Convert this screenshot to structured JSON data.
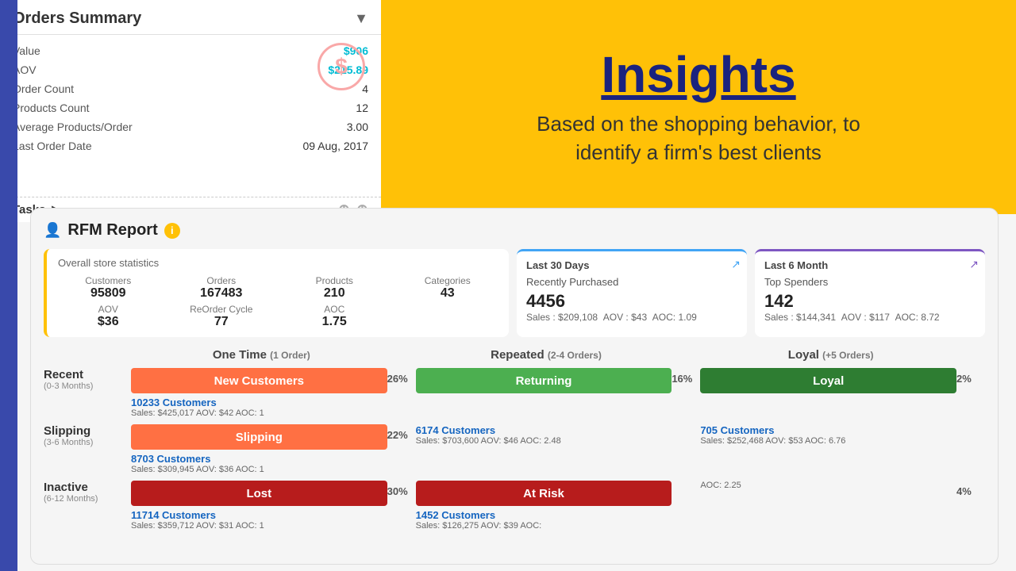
{
  "sidebar": {
    "bg": "#3949AB"
  },
  "orders_summary": {
    "title": "Orders Summary",
    "dropdown_icon": "▼",
    "rows": [
      {
        "label": "Value",
        "value": "$906",
        "teal": true
      },
      {
        "label": "AOV",
        "value": "$215.89",
        "teal": true
      },
      {
        "label": "Order Count",
        "value": "4",
        "teal": false
      },
      {
        "label": "Products Count",
        "value": "12",
        "teal": false
      },
      {
        "label": "Average Products/Order",
        "value": "3.00",
        "teal": false
      },
      {
        "label": "Last Order Date",
        "value": "09 Aug, 2017",
        "teal": false
      }
    ],
    "dollar_icon": "$"
  },
  "tasks": {
    "label": "Tasks",
    "arrow": "▶"
  },
  "right_panel": {
    "title": "Insights",
    "subtitle": "Based on the shopping behavior, to\nidentify a firm's best clients",
    "bg": "#FFC107"
  },
  "rfm": {
    "icon": "👤",
    "title": "RFM Report",
    "info": "i",
    "overall_title": "Overall store statistics",
    "stats": {
      "customers_label": "Customers",
      "customers_value": "95809",
      "orders_label": "Orders",
      "orders_value": "167483",
      "products_label": "Products",
      "products_value": "210",
      "categories_label": "Categories",
      "categories_value": "43",
      "aov_label": "AOV",
      "aov_value": "$36",
      "reorder_label": "ReOrder Cycle",
      "reorder_value": "77",
      "aoc_label": "AOC",
      "aoc_value": "1.75"
    },
    "last30": {
      "title": "Last 30 Days",
      "section_label": "Recently Purchased",
      "count": "4456",
      "sales": "Sales : $209,108",
      "aov": "AOV : $43",
      "aoc": "AOC: 1.09"
    },
    "last6m": {
      "title": "Last 6 Month",
      "section_label": "Top Spenders",
      "count": "142",
      "sales": "Sales : $144,341",
      "aov": "AOV : $117",
      "aoc": "AOC: 8.72"
    },
    "col_headers": [
      {
        "label": "One Time",
        "sub": "(1 Order)"
      },
      {
        "label": "Repeated",
        "sub": "(2-4 Orders)"
      },
      {
        "label": "Loyal",
        "sub": "(+5 Orders)"
      }
    ],
    "rows": [
      {
        "title": "Recent",
        "sub": "(0-3 Months)",
        "col1": {
          "bar_label": "New Customers",
          "bar_color": "orange",
          "customers": "10233 Customers",
          "meta": "Sales: $425,017  AOV: $42  AOC: 1"
        },
        "pct1": "26%",
        "col2": {
          "bar_label": "Returning",
          "bar_color": "green",
          "customers": "",
          "meta": ""
        },
        "pct2": "16%",
        "col3": {
          "bar_label": "Loyal",
          "bar_color": "green-dark",
          "customers": "",
          "meta": ""
        },
        "pct3": "2%"
      },
      {
        "title": "Slipping",
        "sub": "(3-6 Months)",
        "col1": {
          "bar_label": "Slipping",
          "bar_color": "orange",
          "customers": "8703 Customers",
          "meta": "Sales: $309,945  AOV: $36  AOC: 1"
        },
        "pct1": "22%",
        "col2": {
          "bar_label": "",
          "bar_color": "",
          "customers": "6174 Customers",
          "meta": "Sales: $703,600  AOV: $46  AOC: 2.48"
        },
        "pct2": "",
        "col3": {
          "bar_label": "",
          "bar_color": "",
          "customers": "705 Customers",
          "meta": "Sales: $252,468  AOV: $53  AOC: 6.76"
        },
        "pct3": ""
      },
      {
        "title": "Inactive",
        "sub": "(6-12 Months)",
        "col1": {
          "bar_label": "Lost",
          "bar_color": "dark-red",
          "customers": "11714 Customers",
          "meta": "Sales: $359,712  AOV: $31  AOC: 1"
        },
        "pct1": "30%",
        "col2": {
          "bar_label": "At Risk",
          "bar_color": "dark-red",
          "customers": "1452 Customers",
          "meta": "Sales: $126,275  AOV: $39  AOC:"
        },
        "pct2": "",
        "col3": {
          "bar_label": "",
          "bar_color": "",
          "customers": "",
          "meta": "AOC: 2.25"
        },
        "pct3": "4%"
      }
    ]
  }
}
